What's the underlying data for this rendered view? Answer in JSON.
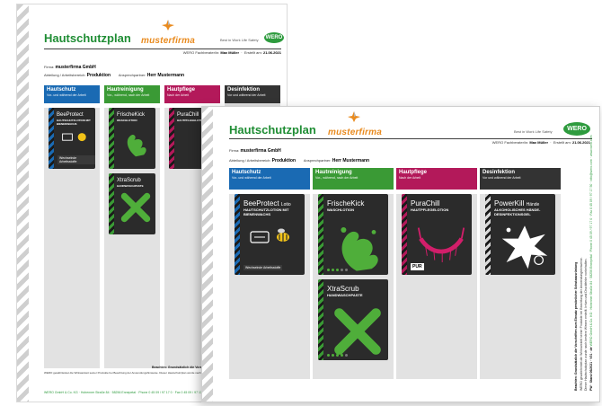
{
  "document": {
    "title": "Hautschutzplan",
    "brand": "musterfirma",
    "tagline": "Best in Work Life Safety",
    "wero_logo": "WERO",
    "prepared_label": "WERO Fachberater/in:",
    "prepared_name": "Max Müller",
    "created_label": "Erstellt am:",
    "created_date": "21.06.2021",
    "company_label": "Firma:",
    "company_name": "musterfirma GmbH",
    "department_label": "Abteilung / Arbeitsbereich:",
    "department_name": "Produktion",
    "contact_label": "Ansprechpartner:",
    "contact_name": "Herr Mustermann"
  },
  "columns": [
    {
      "name": "Hautschutz",
      "sub": "Vor- und während der Arbeit",
      "color": "#1a6ab3"
    },
    {
      "name": "Hautreinigung",
      "sub": "Vor-, während, nach der Arbeit",
      "color": "#3a9a35"
    },
    {
      "name": "Hautpflege",
      "sub": "Nach der Arbeit",
      "color": "#b3195a"
    },
    {
      "name": "Desinfektion",
      "sub": "Vor und während der Arbeit",
      "color": "#333333"
    }
  ],
  "products": {
    "beeprotect": {
      "name": "BeeProtect",
      "suffix": "Lotio",
      "desc": "HAUTSCHUTZLOTION MIT BIENENWACHS",
      "note": "Wechselnde Arbeitsstoffe",
      "band": "#1a6ab3"
    },
    "frischekick": {
      "name": "FrischeKick",
      "desc": "WASCHLOTION",
      "band": "#3a9a35"
    },
    "xtrascrub": {
      "name": "XtraScrub",
      "desc": "HANDWASCHPASTE",
      "band": "#3a9a35"
    },
    "purachill": {
      "name": "PuraChill",
      "desc": "HAUTPFLEGELOTION",
      "badge": "PUR",
      "band": "#b3195a"
    },
    "powerkill": {
      "name": "PowerKill",
      "suffix": "Hände",
      "desc": "ALKOHOLISCHES HÄNDE-DESINFEKTIONSGEL",
      "band": "#d8d8d8"
    }
  },
  "footer": {
    "bold": "Beachten: Grundsätzlich die Vorschriften zum Einsatz persönlicher Schutz",
    "small": "WERO gewährleistet die Wirksamkeit seiner Produkte bei Beachtung der Anwendungshinweise. Dieser Hautschutzplan wurde nach bestem Wissen erstellt. Irrtum und Druckfehler vorbehalten.",
    "contact": "WERO GmbH & Co. KG · Hohenner Straße 84 · 58256 Ennepetal · Phone 0 45 09 / 97 17 0 · Fax 0 45 09 / 97 17 50 · info@wero.com · www.wero.com",
    "side_bold": "Beachten: Grundsätzlich die Vorschriften zum Einsatz persönlicher Schutzausrüstung",
    "side_small": "WERO gewährleistet die Wirksamkeit seiner Produkte bei Beachtung der Anwendungshinweise.",
    "side_small2": "Dieser Hautschutzplan wurde nach bestem Wissen erstellt. Irrtum und Druckfehler vorbehalten.",
    "side_code": "PW · Stand 06/2021 · V01 · de"
  },
  "colors": {
    "green": "#1f8d34",
    "orange": "#e98b1f"
  },
  "icons": [
    "musterfirma-logo-icon",
    "wero-logo",
    "warning-stripe",
    "bee-icon",
    "splash-icon",
    "cross-brush-icon",
    "hammock-icon",
    "virus-burst-icon",
    "rating-dots"
  ]
}
